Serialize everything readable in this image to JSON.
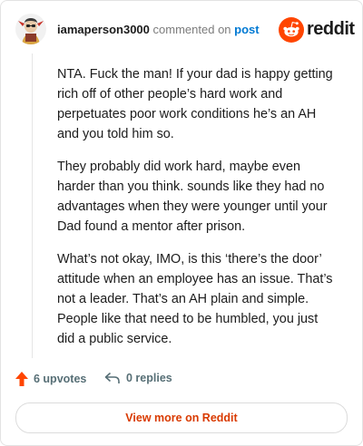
{
  "comment": {
    "username": "iamaperson3000",
    "action_text": "commented on",
    "post_link_text": "post",
    "paragraphs": [
      "NTA. Fuck the man! If your dad is happy getting rich off of other people’s hard work and perpetuates poor work conditions he’s an AH and you told him so.",
      "They probably did work hard, maybe even harder than you think. sounds like they had no advantages when they were younger until your Dad found a mentor after prison.",
      "What’s not okay, IMO, is this ‘there’s the door’ attitude when an employee has an issue. That’s not a leader. That’s an AH plain and simple. People like that need to be humbled, you just did a public service."
    ]
  },
  "brand": {
    "wordmark": "reddit",
    "color": "#ff4500"
  },
  "actions": {
    "upvotes_label": "6 upvotes",
    "replies_label": "0 replies",
    "upvote_color": "#ff4500"
  },
  "footer": {
    "view_more_label": "View more on Reddit",
    "label_color": "#d93a00"
  }
}
